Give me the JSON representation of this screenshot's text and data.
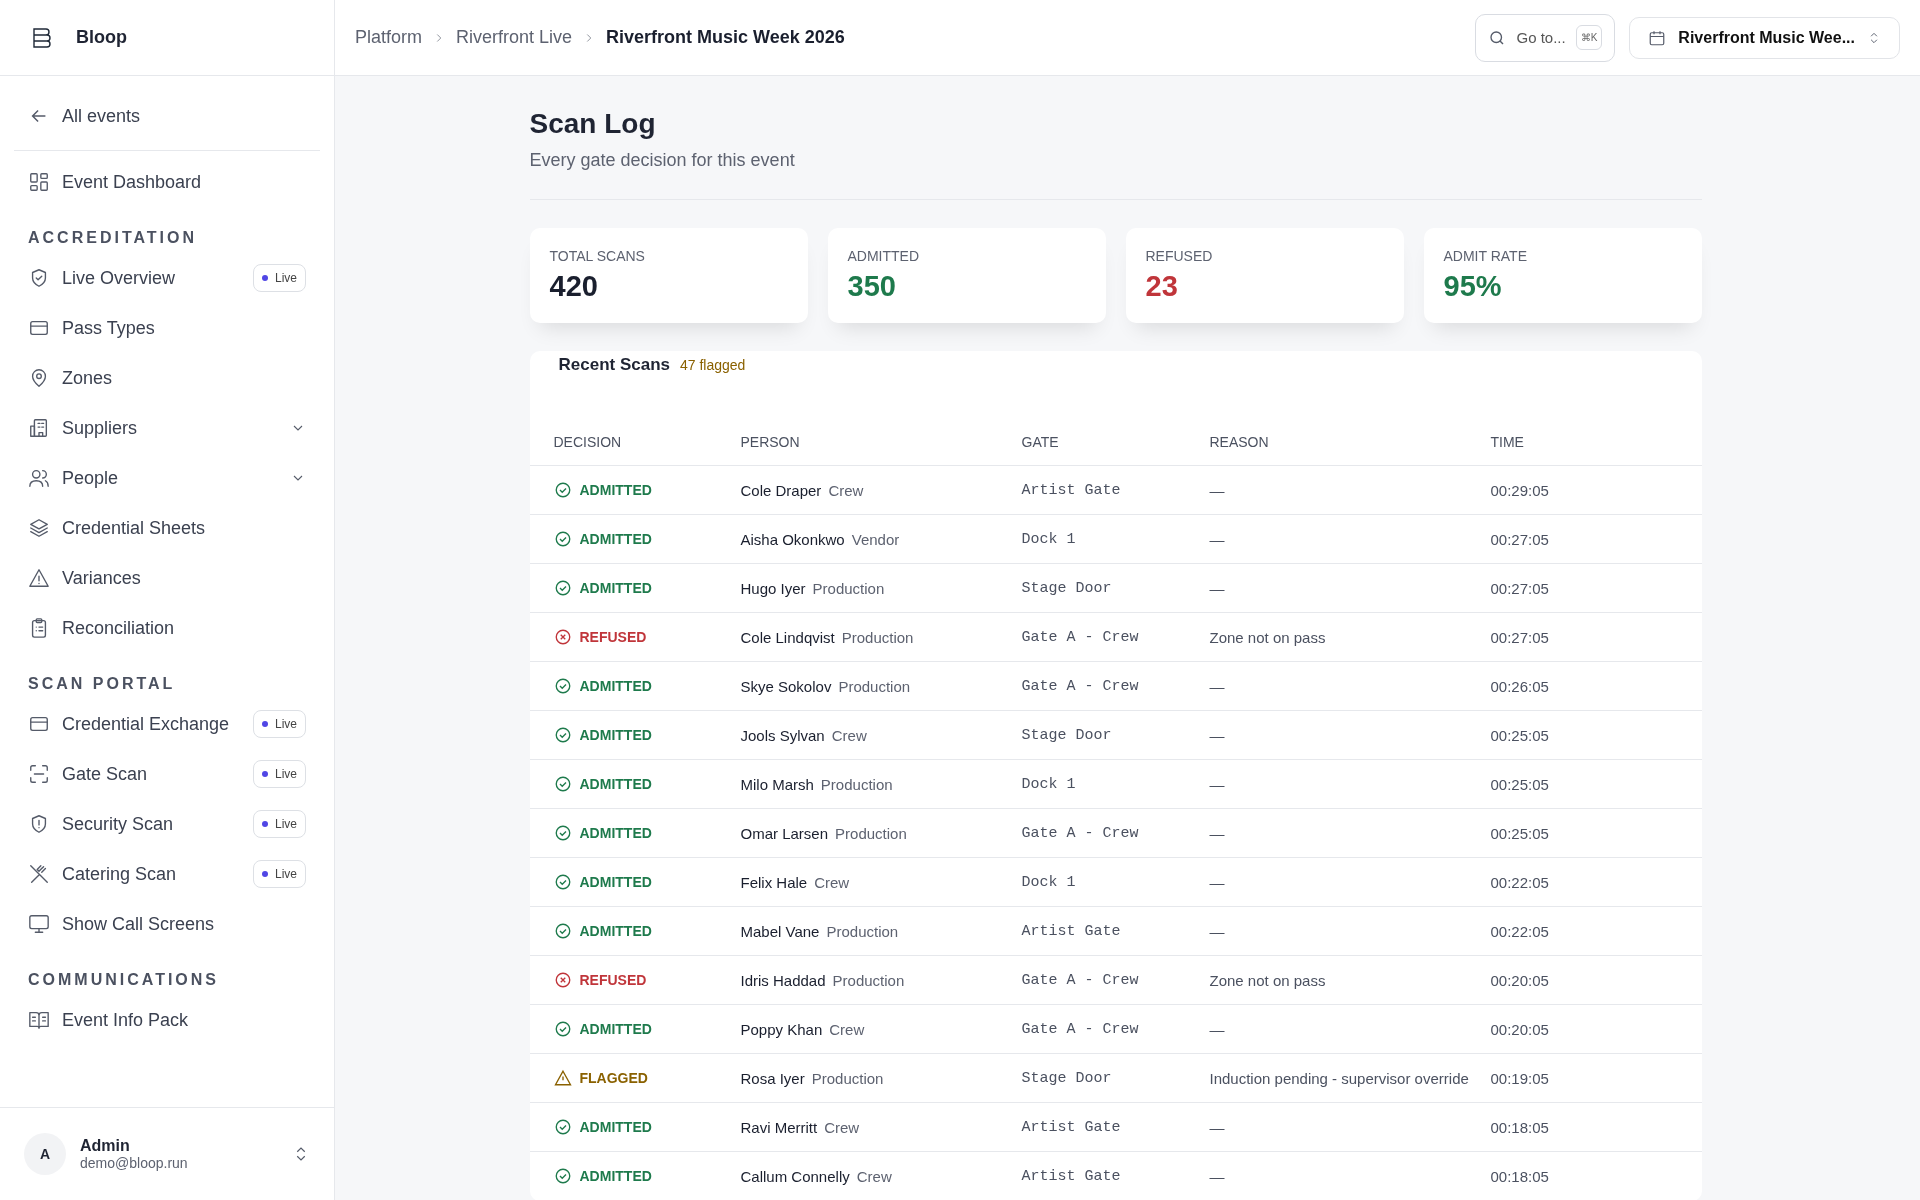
{
  "brand": {
    "name": "Bloop"
  },
  "sidebar": {
    "back": "All events",
    "top_items": [
      {
        "label": "Event Dashboard",
        "selected": false
      }
    ],
    "sections": [
      {
        "title": "ACCREDITATION",
        "items": [
          {
            "label": "Live Overview",
            "badge": "Live",
            "expandable": false
          },
          {
            "label": "Pass Types",
            "expandable": false
          },
          {
            "label": "Zones",
            "expandable": false
          },
          {
            "label": "Suppliers",
            "expandable": true
          },
          {
            "label": "People",
            "expandable": true
          },
          {
            "label": "Credential Sheets",
            "expandable": false
          },
          {
            "label": "Variances",
            "expandable": false
          },
          {
            "label": "Reconciliation",
            "expandable": false
          }
        ]
      },
      {
        "title": "SCAN PORTAL",
        "items": [
          {
            "label": "Credential Exchange",
            "badge": "Live",
            "expandable": false
          },
          {
            "label": "Gate Scan",
            "badge": "Live",
            "expandable": false
          },
          {
            "label": "Security Scan",
            "badge": "Live",
            "expandable": false
          },
          {
            "label": "Catering Scan",
            "badge": "Live",
            "expandable": false
          },
          {
            "label": "Show Call Screens",
            "expandable": false
          }
        ]
      },
      {
        "title": "COMMUNICATIONS",
        "items": [
          {
            "label": "Event Info Pack",
            "expandable": false
          }
        ]
      }
    ],
    "user": {
      "initial": "A",
      "name": "Admin",
      "email": "demo@bloop.run"
    }
  },
  "breadcrumbs": [
    "Platform",
    "Riverfront Live",
    "Riverfront Music Week 2026"
  ],
  "goto": {
    "label": "Go to...",
    "shortcut": "⌘K"
  },
  "event_selector": {
    "value": "Riverfront Music Wee..."
  },
  "page": {
    "title": "Scan Log",
    "subtitle": "Every gate decision for this event"
  },
  "stats": [
    {
      "label": "TOTAL SCANS",
      "value": "420",
      "kind": "neutral"
    },
    {
      "label": "ADMITTED",
      "value": "350",
      "kind": "good"
    },
    {
      "label": "REFUSED",
      "value": "23",
      "kind": "bad"
    },
    {
      "label": "ADMIT RATE",
      "value": "95%",
      "kind": "good"
    }
  ],
  "table": {
    "title": "Recent Scans",
    "flagged": "47 flagged",
    "columns": [
      "DECISION",
      "PERSON",
      "GATE",
      "REASON",
      "TIME"
    ],
    "rows": [
      {
        "kind": "admitted",
        "decision": "ADMITTED",
        "name": "Cole Draper",
        "role": "Crew",
        "gate": "Artist Gate",
        "reason": "—",
        "time": "00:29:05"
      },
      {
        "kind": "admitted",
        "decision": "ADMITTED",
        "name": "Aisha Okonkwo",
        "role": "Vendor",
        "gate": "Dock 1",
        "reason": "—",
        "time": "00:27:05"
      },
      {
        "kind": "admitted",
        "decision": "ADMITTED",
        "name": "Hugo Iyer",
        "role": "Production",
        "gate": "Stage Door",
        "reason": "—",
        "time": "00:27:05"
      },
      {
        "kind": "refused",
        "decision": "REFUSED",
        "name": "Cole Lindqvist",
        "role": "Production",
        "gate": "Gate A - Crew",
        "reason": "Zone not on pass",
        "time": "00:27:05"
      },
      {
        "kind": "admitted",
        "decision": "ADMITTED",
        "name": "Skye Sokolov",
        "role": "Production",
        "gate": "Gate A - Crew",
        "reason": "—",
        "time": "00:26:05"
      },
      {
        "kind": "admitted",
        "decision": "ADMITTED",
        "name": "Jools Sylvan",
        "role": "Crew",
        "gate": "Stage Door",
        "reason": "—",
        "time": "00:25:05"
      },
      {
        "kind": "admitted",
        "decision": "ADMITTED",
        "name": "Milo Marsh",
        "role": "Production",
        "gate": "Dock 1",
        "reason": "—",
        "time": "00:25:05"
      },
      {
        "kind": "admitted",
        "decision": "ADMITTED",
        "name": "Omar Larsen",
        "role": "Production",
        "gate": "Gate A - Crew",
        "reason": "—",
        "time": "00:25:05"
      },
      {
        "kind": "admitted",
        "decision": "ADMITTED",
        "name": "Felix Hale",
        "role": "Crew",
        "gate": "Dock 1",
        "reason": "—",
        "time": "00:22:05"
      },
      {
        "kind": "admitted",
        "decision": "ADMITTED",
        "name": "Mabel Vane",
        "role": "Production",
        "gate": "Artist Gate",
        "reason": "—",
        "time": "00:22:05"
      },
      {
        "kind": "refused",
        "decision": "REFUSED",
        "name": "Idris Haddad",
        "role": "Production",
        "gate": "Gate A - Crew",
        "reason": "Zone not on pass",
        "time": "00:20:05"
      },
      {
        "kind": "admitted",
        "decision": "ADMITTED",
        "name": "Poppy Khan",
        "role": "Crew",
        "gate": "Gate A - Crew",
        "reason": "—",
        "time": "00:20:05"
      },
      {
        "kind": "flagged",
        "decision": "FLAGGED",
        "name": "Rosa Iyer",
        "role": "Production",
        "gate": "Stage Door",
        "reason": "Induction pending - supervisor override",
        "time": "00:19:05"
      },
      {
        "kind": "admitted",
        "decision": "ADMITTED",
        "name": "Ravi Merritt",
        "role": "Crew",
        "gate": "Artist Gate",
        "reason": "—",
        "time": "00:18:05"
      },
      {
        "kind": "admitted",
        "decision": "ADMITTED",
        "name": "Callum Connelly",
        "role": "Crew",
        "gate": "Artist Gate",
        "reason": "—",
        "time": "00:18:05"
      }
    ]
  }
}
